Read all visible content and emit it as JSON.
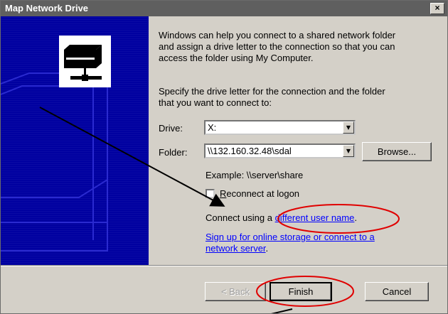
{
  "dialog": {
    "title": "Map Network Drive",
    "close_glyph": "×"
  },
  "intro": {
    "line1": "Windows can help you connect to a shared network folder",
    "line2": "and assign a drive letter to the connection so that you can",
    "line3": "access the folder using My Computer."
  },
  "instructions": {
    "line1": "Specify the drive letter for the connection and the folder",
    "line2": "that you want to connect to:"
  },
  "drive": {
    "label": "Drive:",
    "value": "X:"
  },
  "folder": {
    "label": "Folder:",
    "value": "\\\\132.160.32.48\\sdal"
  },
  "browse_label": "Browse...",
  "example_text": "Example: \\\\server\\share",
  "reconnect": {
    "label": "Reconnect at logon",
    "checked": false
  },
  "connect_using": {
    "prefix": "Connect using a ",
    "link": "different user name",
    "suffix": "."
  },
  "signup": {
    "line1": "Sign up for online storage or connect to a",
    "line2": "network server",
    "suffix": "."
  },
  "buttons": {
    "back": "< Back",
    "finish": "Finish",
    "cancel": "Cancel"
  },
  "icons": [
    "network-drive-icon",
    "close-icon",
    "dropdown-arrow-icon"
  ],
  "colors": {
    "left_panel": "#0000a0",
    "title_bar": "#5f5f5f",
    "annotation": "#e00000",
    "link": "#0000ff"
  }
}
